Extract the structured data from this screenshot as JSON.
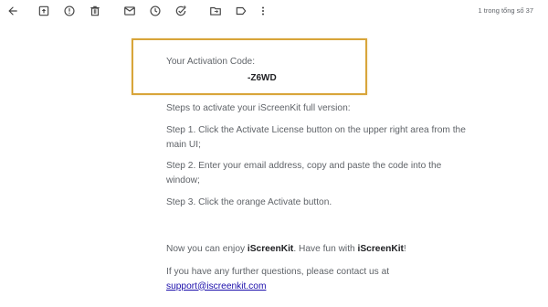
{
  "toolbar": {
    "icons": [
      "back-arrow-icon",
      "archive-icon",
      "report-spam-icon",
      "delete-icon",
      "mark-unread-icon",
      "snooze-icon",
      "add-task-icon",
      "move-to-icon",
      "label-icon",
      "more-vertical-icon"
    ],
    "pager_text": "1 trong tổng số 37"
  },
  "email": {
    "activation_label": "Your Activation Code:",
    "activation_code": "-Z6WD",
    "steps_intro": "Steps to activate your iScreenKit full version:",
    "step1": "Step 1. Click the Activate License button on the upper right area from the main UI;",
    "step2": "Step 2. Enter your email address, copy and paste the code into the window;",
    "step3": "Step 3. Click the orange Activate button.",
    "enjoy_prefix": "Now you can enjoy ",
    "enjoy_brand": "iScreenKit",
    "enjoy_middle": ". Have fun with ",
    "enjoy_brand2": "iScreenKit",
    "enjoy_suffix": "!",
    "contact_text": "If you have any further questions, please contact us at",
    "contact_email": "support@iscreenkit.com"
  },
  "colors": {
    "highlight_border": "#d8a53a",
    "text": "#5f6368",
    "link": "#1a0dab"
  }
}
